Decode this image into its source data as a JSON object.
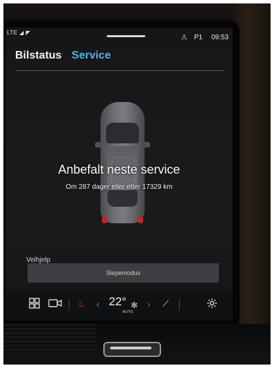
{
  "status_bar": {
    "network": "LTE",
    "profile": "P1",
    "time": "09:53"
  },
  "tabs": [
    {
      "label": "Bilstatus",
      "active": false
    },
    {
      "label": "Service",
      "active": true
    }
  ],
  "service": {
    "title": "Anbefalt neste service",
    "subtitle": "Om 287 dager eller etter 17329 km"
  },
  "roadside": {
    "label": "Veihjelp",
    "tow_button": "Slepemodus"
  },
  "climate": {
    "temperature": "22°",
    "mode": "AUTO",
    "icons": [
      "grid-icon",
      "camera-icon",
      "seat-heat-icon",
      "arrow-left-icon",
      "fan-icon",
      "arrow-right-icon",
      "seat-icon",
      "settings-icon"
    ]
  },
  "colors": {
    "accent": "#4cb3e6",
    "seat_heat": "#e23b3b"
  }
}
